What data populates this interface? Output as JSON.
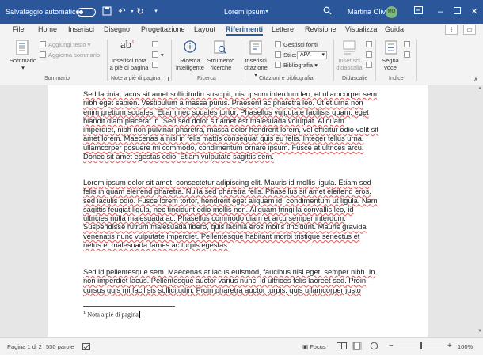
{
  "titlebar": {
    "autosave_label": "Salvataggio automatico",
    "doc_title": "Lorem ipsum",
    "user_name": "Martina Oliva",
    "avatar_initials": "MO",
    "autosave_on": false,
    "bg_color": "#2b579a"
  },
  "tabs": [
    "File",
    "Home",
    "Inserisci",
    "Disegno",
    "Progettazione",
    "Layout",
    "Riferimenti",
    "Lettere",
    "Revisione",
    "Visualizza",
    "Guida"
  ],
  "active_tab": "Riferimenti",
  "ribbon": {
    "groups": {
      "sommario": {
        "label": "Sommario",
        "sommario_button": "Sommario",
        "aggiungi_testo": "Aggiungi testo",
        "aggiorna_sommario": "Aggiorna sommario"
      },
      "note": {
        "label": "Note a piè di pagina",
        "inserisci_nota_line1": "Inserisci nota",
        "inserisci_nota_line2": "a piè di pagina",
        "ab_glyph": "ab",
        "superscript": "1"
      },
      "ricerca": {
        "label": "Ricerca",
        "ricerca_intelligente_line1": "Ricerca",
        "ricerca_intelligente_line2": "intelligente",
        "strumento_line1": "Strumento",
        "strumento_line2": "ricerche"
      },
      "citazioni": {
        "label": "Citazioni e bibliografia",
        "inserisci_citazione_line1": "Inserisci",
        "inserisci_citazione_line2": "citazione",
        "gestisci_fonti": "Gestisci fonti",
        "stile_label": "Stile:",
        "stile_value": "APA",
        "bibliografia": "Bibliografia"
      },
      "didascalie": {
        "label": "Didascalie",
        "inserisci_didascalia_line1": "Inserisci",
        "inserisci_didascalia_line2": "didascalia"
      },
      "indice": {
        "label": "Indice",
        "segna_voce_line1": "Segna",
        "segna_voce_line2": "voce"
      }
    }
  },
  "document": {
    "paragraphs": [
      "Sed lacinia, lacus sit amet sollicitudin suscipit, nisi ipsum interdum leo, et ullamcorper sem\nnibh eget sapien. Vestibulum a massa purus. Praesent ac pharetra leo. Ut et urna non\nenim pretium sodales. Etiam nec sodales tortor. Phasellus vulputate facilisis quam, eget\nblandit diam placerat in. Sed sed dolor sit amet est malesuada volutpat. Aliquam\nimperdiet, nibh non pulvinar pharetra, massa dolor hendrerit lorem, vel efficitur odio velit sit\namet lorem. Maecenas a nisl in felis mattis consequat quis eu felis. Integer tellus urna,\nullamcorper posuere mi commodo, condimentum ornare ipsum. Fusce at ultrices arcu.\nDonec sit amet egestas odio. Etiam vulputate sagittis sem.",
      "Lorem ipsum dolor sit amet, consectetur adipiscing elit. Mauris id mollis ligula. Etiam sed\nfelis in quam eleifend pharetra. Nulla sed pharetra felis. Phasellus sit amet eleifend eros,\nsed iaculis odio. Fusce lorem tortor, hendrerit eget aliquam id, condimentum ut ligula. Nam\nsagittis feugiat ligula, nec tincidunt odio mollis non. Aliquam fringilla convallis leo, id\nultricies nulla malesuada ac. Phasellus commodo diam et arcu semper interdum.\nSuspendisse rutrum malesuada libero, quis lacinia eros mollis tincidunt. Mauris gravida\nvenenatis nunc vulputate imperdiet. Pellentesque habitant morbi tristique senectus et\nnetus et malesuada fames ac turpis egestas.",
      "Sed id pellentesque sem. Maecenas at lacus euismod, faucibus nisi eget, semper nibh. In\nnon imperdiet lacus. Pellentesque auctor varius nunc, id ultrices felis laoreet sed. Proin\ncursus quis mi facilisis sollicitudin. Proin pharetra auctor turpis, quis ullamcorper justo"
    ],
    "footnote_number": "1",
    "footnote_text": "Nota a piè di pagina"
  },
  "statusbar": {
    "page_info": "Pagina 1 di 2",
    "word_count": "530 parole",
    "focus_label": "Focus",
    "zoom": "100%"
  },
  "colors": {
    "accent": "#2b579a",
    "spellcheck_underline": "#e25c5c"
  }
}
